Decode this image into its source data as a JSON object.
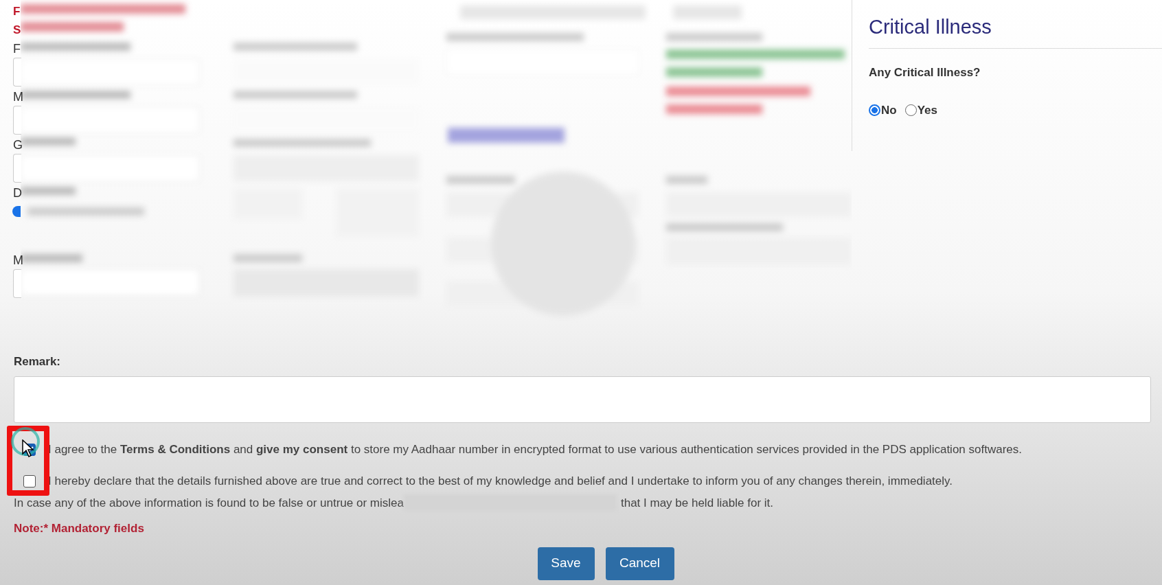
{
  "notice_letters": [
    "F",
    "S"
  ],
  "field_letters": [
    {
      "text": "F",
      "kind": "field"
    },
    {
      "text": "M",
      "kind": "field"
    },
    {
      "text": "G",
      "kind": "field"
    },
    {
      "text": "D",
      "kind": "radio",
      "selected": true
    },
    {
      "text": "M",
      "kind": "field"
    }
  ],
  "critical_illness": {
    "title": "Critical Illness",
    "question": "Any Critical Illness?",
    "options": [
      {
        "label": "No",
        "selected": true
      },
      {
        "label": "Yes",
        "selected": false
      }
    ]
  },
  "remark": {
    "label": "Remark:"
  },
  "declarations": [
    {
      "checked": true,
      "text": "I agree to the **Terms & Conditions** and **give my consent** to store my Aadhaar number in encrypted format to use various authentication services provided in the PDS application softwares."
    },
    {
      "checked": false,
      "text": "I hereby declare that the details furnished above are true and correct to the best of my knowledge and belief and I undertake to inform you of any changes therein, immediately."
    }
  ],
  "continuation": {
    "before": "In case any of the above information is found to be false or untrue or mislea",
    "after": "that I may be held liable for it."
  },
  "note": "Note:* Mandatory fields",
  "buttons": [
    "Save",
    "Cancel"
  ]
}
